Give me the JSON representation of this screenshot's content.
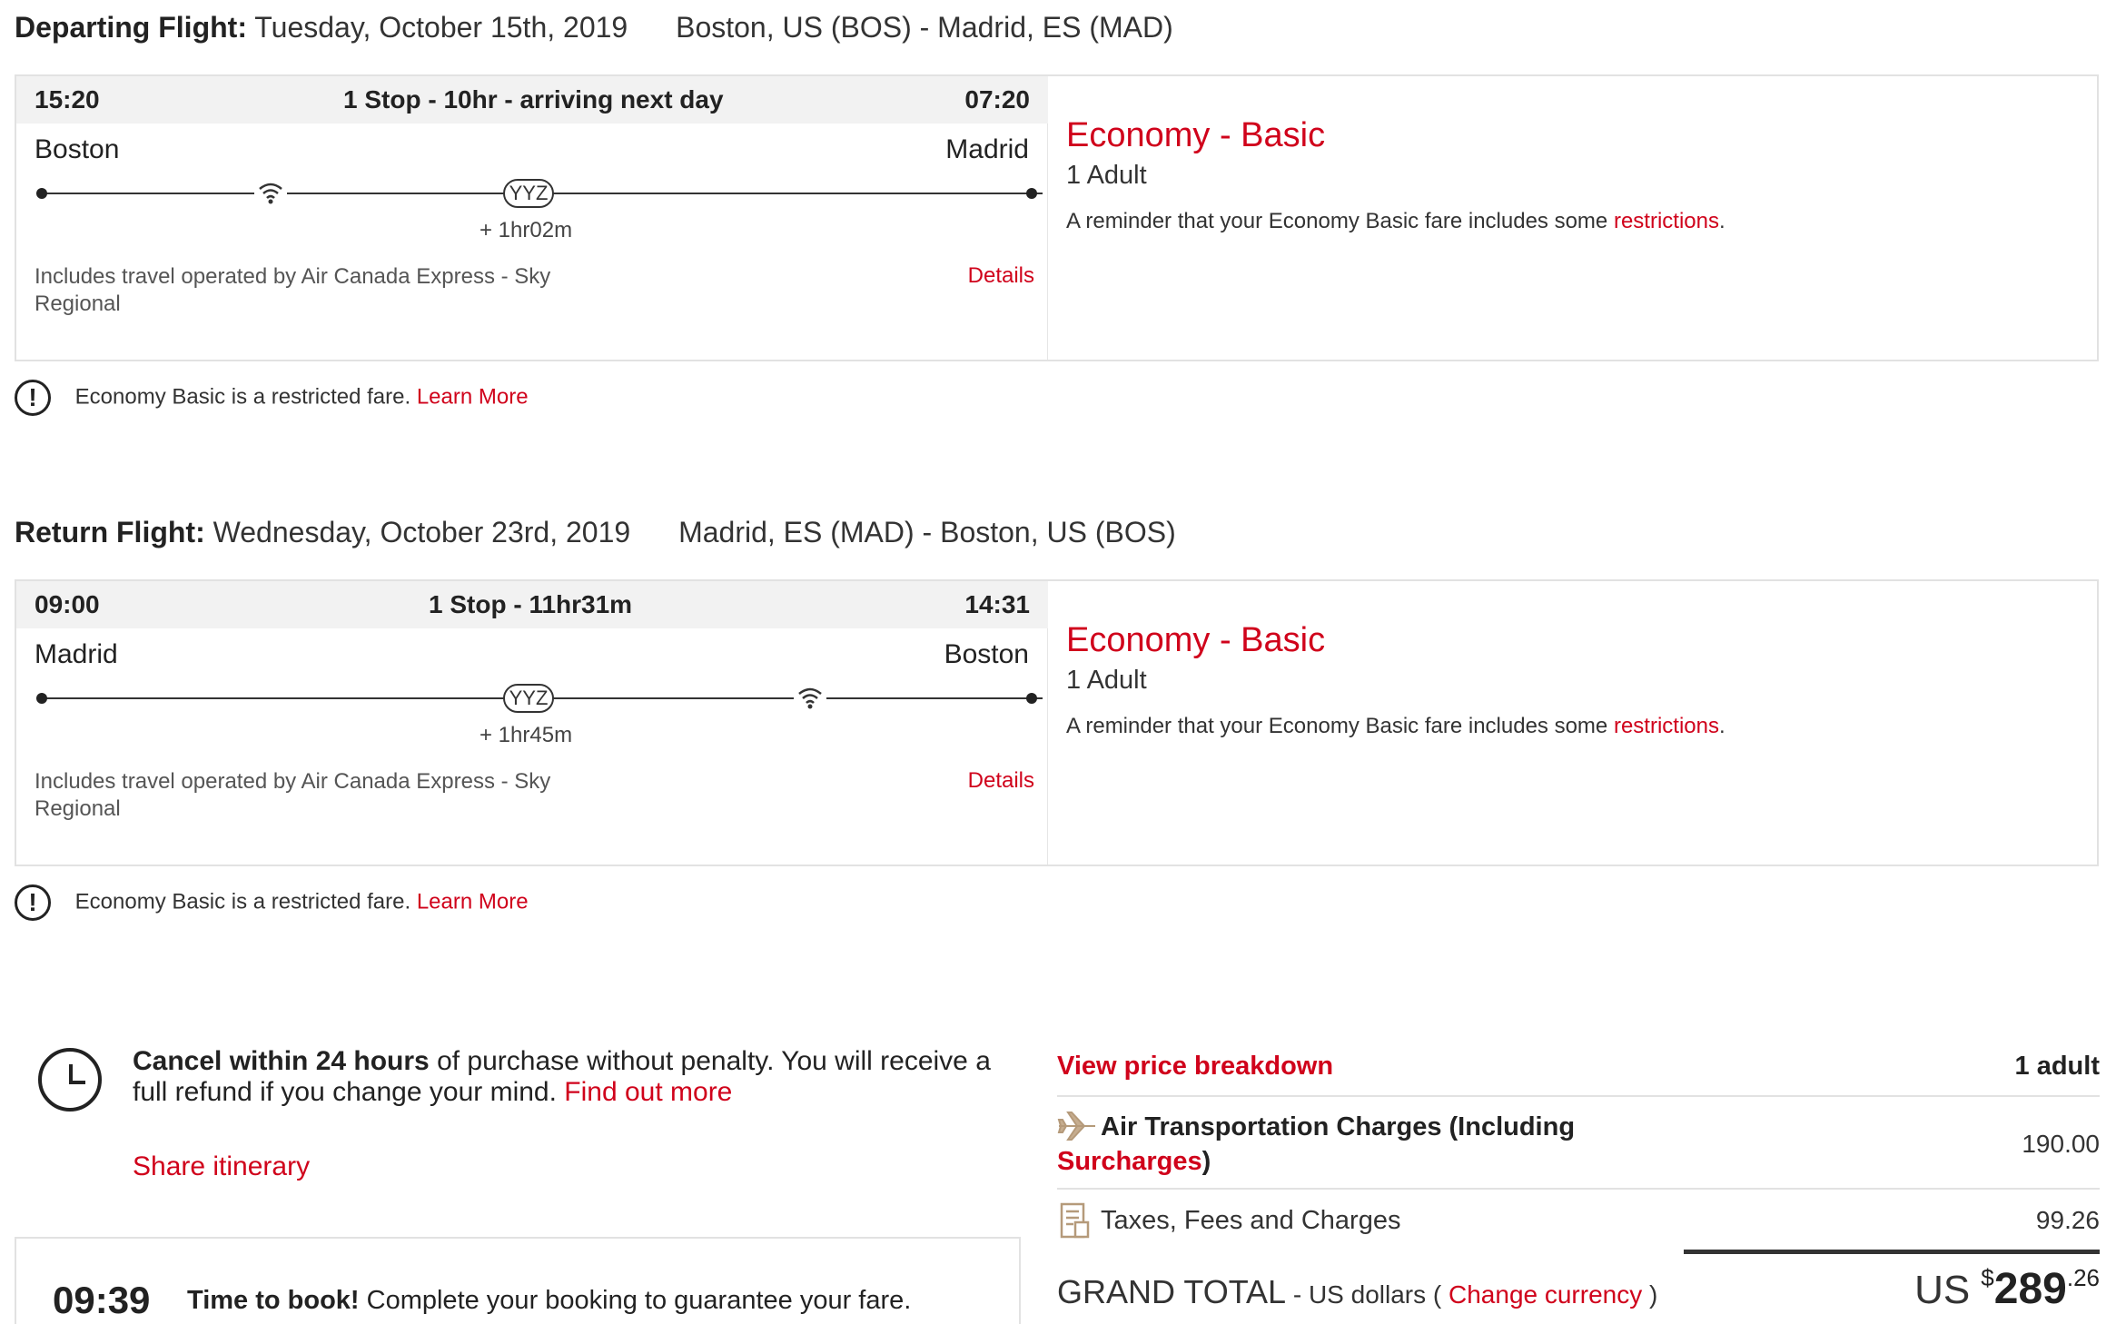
{
  "departing": {
    "heading_label": "Departing Flight:",
    "date": "Tuesday, October 15th, 2019",
    "route": "Boston, US (BOS) - Madrid, ES (MAD)",
    "depart_time": "15:20",
    "summary": "1 Stop - 10hr - arriving next day",
    "arrive_time": "07:20",
    "origin": "Boston",
    "destination": "Madrid",
    "stop_code": "YYZ",
    "layover": "+ 1hr02m",
    "operated_by": "Includes travel operated by Air Canada Express - Sky Regional",
    "details_link": "Details",
    "fare_title": "Economy - Basic",
    "passengers": "1 Adult",
    "reminder_text": "A reminder that your Economy Basic fare includes some ",
    "reminder_link": "restrictions",
    "reminder_end": ".",
    "restricted_text": "Economy Basic is a restricted fare. ",
    "learn_more": "Learn More"
  },
  "returning": {
    "heading_label": "Return Flight:",
    "date": "Wednesday, October 23rd, 2019",
    "route": "Madrid, ES (MAD) - Boston, US (BOS)",
    "depart_time": "09:00",
    "summary": "1 Stop - 11hr31m",
    "arrive_time": "14:31",
    "origin": "Madrid",
    "destination": "Boston",
    "stop_code": "YYZ",
    "layover": "+ 1hr45m",
    "operated_by": "Includes travel operated by Air Canada Express - Sky Regional",
    "details_link": "Details",
    "fare_title": "Economy - Basic",
    "passengers": "1 Adult",
    "reminder_text": "A reminder that your Economy Basic fare includes some ",
    "reminder_link": "restrictions",
    "reminder_end": ".",
    "restricted_text": "Economy Basic is a restricted fare. ",
    "learn_more": "Learn More"
  },
  "cancel_policy": {
    "bold": "Cancel within 24 hours",
    "text": " of purchase without penalty. You will receive a full refund if you change your mind. ",
    "link": "Find out more"
  },
  "share_link": "Share itinerary",
  "timer": {
    "value": "09:39",
    "bold": "Time to book!",
    "text": " Complete your booking to guarantee your fare."
  },
  "price": {
    "breakdown_link": "View price breakdown",
    "passenger_count": "1 adult",
    "air_label_a": "Air Transportation Charges (Including ",
    "air_label_link": "Surcharges",
    "air_label_b": ")",
    "air_amount": "190.00",
    "taxes_label": "Taxes, Fees and Charges",
    "taxes_amount": "99.26",
    "grand_label": "GRAND TOTAL",
    "currency_text": " - US dollars ( ",
    "change_currency": "Change currency",
    "currency_close": " )",
    "total_prefix": "US",
    "total_symbol": "$",
    "total_whole": "289",
    "total_cents": ".26"
  },
  "colors": {
    "accent": "#d0021b",
    "text": "#333333",
    "bar": "#f2f2f2",
    "border": "#e2e2e2"
  }
}
